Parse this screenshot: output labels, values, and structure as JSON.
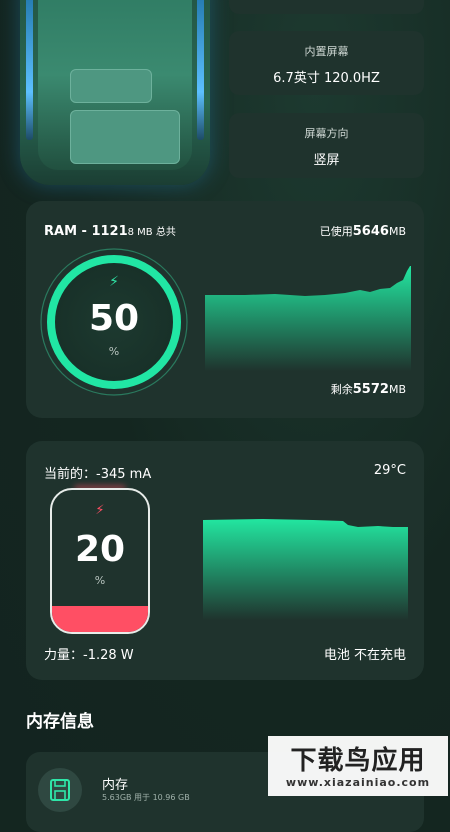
{
  "device_info": [
    {
      "label": "内置屏幕",
      "value": "6.7英寸 120.0HZ"
    },
    {
      "label": "屏幕方向",
      "value": "竖屏"
    }
  ],
  "ram": {
    "title_prefix": "RAM - 1121",
    "title_unit": "8 MB 总共",
    "used_label": "已使用",
    "used_value": "5646",
    "used_unit": "MB",
    "usage_percent": "50",
    "percent_sign": "%",
    "remaining_label": "剩余",
    "remaining_value": "5572",
    "remaining_unit": "MB",
    "bolt_icon": "bolt-icon"
  },
  "battery": {
    "current_label": "当前的：",
    "current_value": "-345 mA",
    "temperature": "29°C",
    "level": "20",
    "percent_sign": "%",
    "power_label": "力量：",
    "power_value": "-1.28 W",
    "status_label": "电池",
    "status_value": "不在充电",
    "level_fraction": 0.2
  },
  "storage_section": {
    "title": "内存信息",
    "items": [
      {
        "name": "内存",
        "detail": "5.63GB 用于 10.96 GB",
        "icon": "save-icon"
      }
    ]
  },
  "watermark": {
    "main": "下载鸟应用",
    "sub": "www.xiazainiao.com"
  },
  "colors": {
    "background": "#142620",
    "card": "#1f332d",
    "accent_green": "#2fe6a8",
    "battery_red": "#ff4f64"
  }
}
